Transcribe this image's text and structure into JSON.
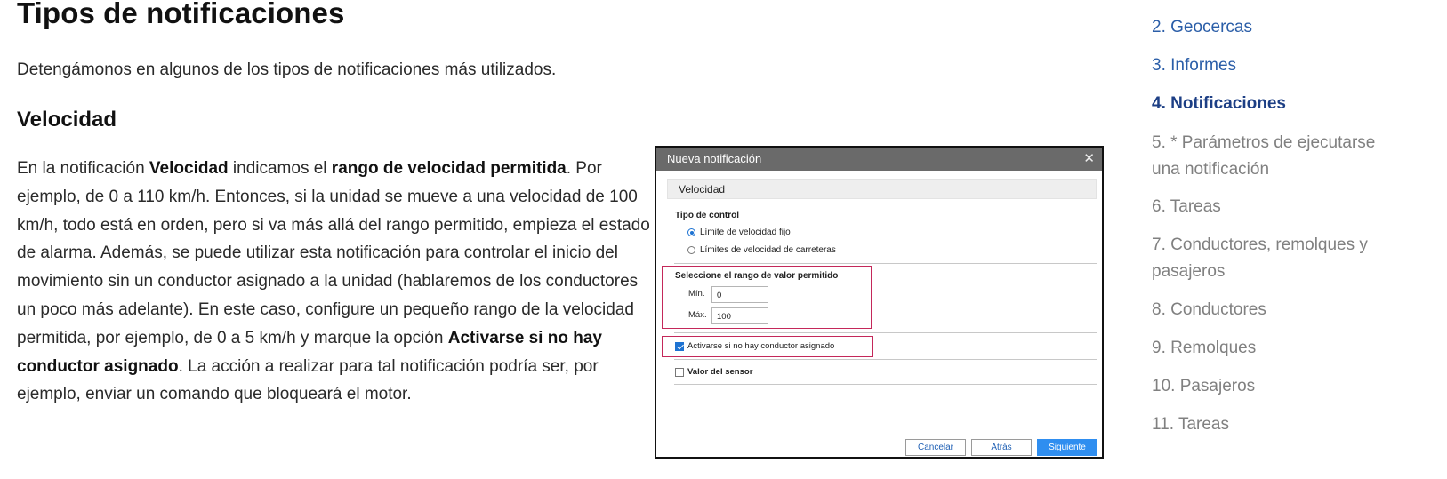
{
  "article": {
    "title": "Tipos de notificaciones",
    "intro": "Detengámonos en algunos de los tipos de notificaciones más utilizados.",
    "section_title": "Velocidad",
    "paragraph": {
      "p1": "En la notificación ",
      "b1": "Velocidad",
      "p2": " indicamos el ",
      "b2": "rango de velocidad permitida",
      "p3": ". Por ejemplo, de 0 a 110 km/h. Entonces, si la unidad se mueve a una velocidad de 100 km/h, todo está en orden, pero si va más allá del rango permitido, empieza el estado de alarma. Además, se puede utilizar esta notificación para controlar el inicio del movimiento sin un conductor asignado a la unidad (hablaremos de los conductores un poco más adelante). En este caso, configure un pequeño rango de la velocidad permitida, por ejemplo, de 0 a 5 km/h y marque la opción ",
      "b3": "Activarse si no hay conductor asignado",
      "p4": ". La acción a realizar para tal notificación podría ser, por ejemplo, enviar un comando que bloqueará el motor."
    }
  },
  "dialog": {
    "title": "Nueva notificación",
    "close_icon": "close-icon",
    "section_header": "Velocidad",
    "control_type_label": "Tipo de control",
    "radio_options": [
      {
        "label": "Límite de velocidad fijo",
        "selected": true
      },
      {
        "label": "Límites de velocidad de carreteras",
        "selected": false
      }
    ],
    "range_label": "Seleccione el rango de valor permitido",
    "min_label": "Mín.",
    "min_value": "0",
    "max_label": "Máx.",
    "max_value": "100",
    "no_driver_checkbox": {
      "label": "Activarse si no hay conductor asignado",
      "checked": true
    },
    "sensor_checkbox": {
      "label": "Valor del sensor",
      "checked": false
    },
    "buttons": {
      "cancel": "Cancelar",
      "back": "Atrás",
      "next": "Siguiente"
    },
    "highlight_color": "#c4285a",
    "accent_color": "#2f8ef0"
  },
  "toc": {
    "items": [
      {
        "line1": "2. Geocercas",
        "line2": "",
        "state": "link"
      },
      {
        "line1": "3. Informes",
        "line2": "",
        "state": "link"
      },
      {
        "line1": "4. Notificaciones",
        "line2": "",
        "state": "active"
      },
      {
        "line1": "5. * Parámetros de ejecutarse",
        "line2": "una notificación",
        "state": "muted"
      },
      {
        "line1": "6. Tareas",
        "line2": "",
        "state": "muted"
      },
      {
        "line1": "7. Conductores, remolques y",
        "line2": "pasajeros",
        "state": "muted"
      },
      {
        "line1": "8. Conductores",
        "line2": "",
        "state": "muted"
      },
      {
        "line1": "9. Remolques",
        "line2": "",
        "state": "muted"
      },
      {
        "line1": "10. Pasajeros",
        "line2": "",
        "state": "muted"
      },
      {
        "line1": "11. Tareas",
        "line2": "",
        "state": "muted"
      }
    ]
  }
}
